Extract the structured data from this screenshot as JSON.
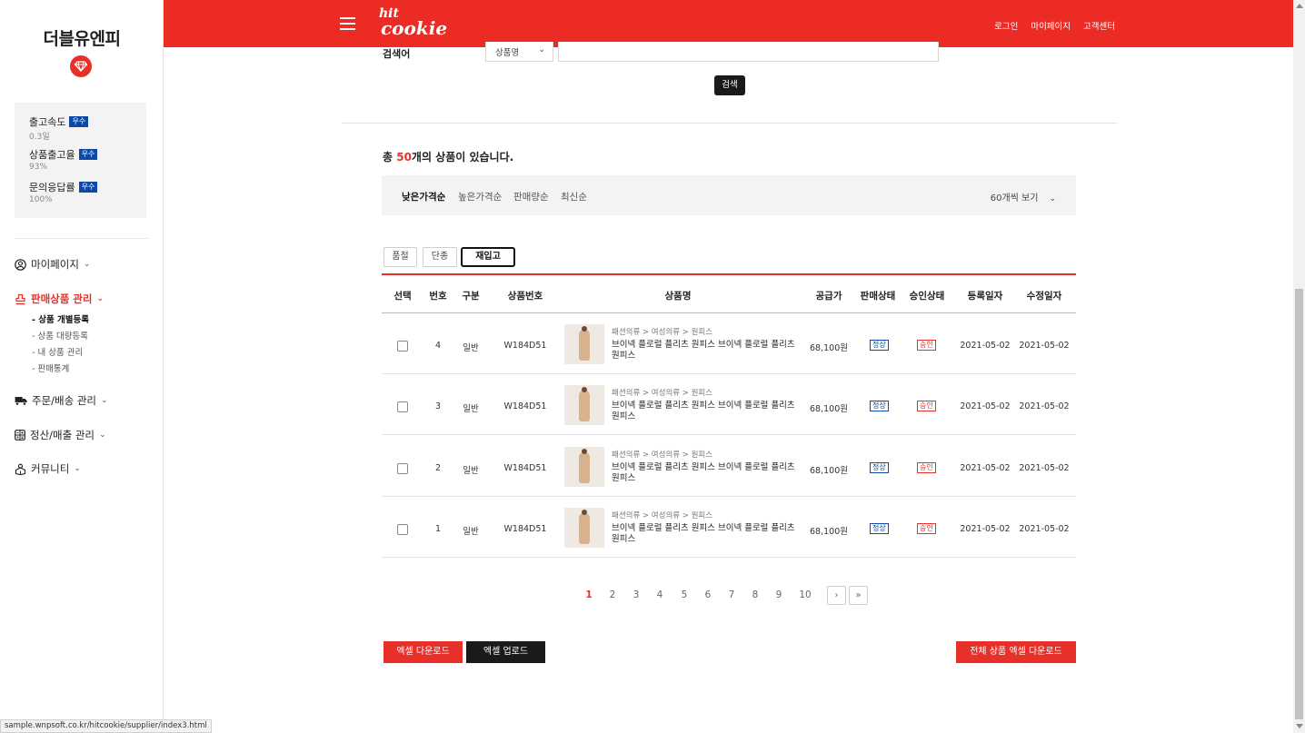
{
  "sidebar": {
    "brand": "더블유엔피",
    "stats": [
      {
        "label": "출고속도",
        "badge": "우수",
        "value": "0.3일"
      },
      {
        "label": "상품출고율",
        "badge": "우수",
        "value": "93%"
      },
      {
        "label": "문의응답률",
        "badge": "우수",
        "value": "100%"
      }
    ],
    "nav": [
      {
        "label": "마이페이지",
        "icon": "user-circle-icon"
      },
      {
        "label": "판매상품 관리",
        "icon": "stamp-icon",
        "active": true,
        "sub": [
          "- 상품 개별등록",
          "- 상품 대량등록",
          "- 내 상품 관리",
          "- 판매통계"
        ]
      },
      {
        "label": "주문/배송 관리",
        "icon": "truck-icon"
      },
      {
        "label": "정산/매출 관리",
        "icon": "calculator-icon"
      },
      {
        "label": "커뮤니티",
        "icon": "people-icon"
      }
    ]
  },
  "topbar": {
    "logo_line1": "hit",
    "logo_line2": "cookie",
    "links": [
      "로그인",
      "마이페이지",
      "고객센터"
    ],
    "color": "#ed2b25"
  },
  "search": {
    "label": "검색어",
    "select_value": "상품명",
    "button": "검색"
  },
  "summary": {
    "prefix": "총 ",
    "count": "50",
    "suffix": "개의 상품이 있습니다."
  },
  "sort": {
    "options": [
      "낮은가격순",
      "높은가격순",
      "판매량순",
      "최신순"
    ],
    "per_page": "60개씩 보기"
  },
  "tabs": [
    "품절",
    "단종",
    "재입고"
  ],
  "table": {
    "headers": [
      "선택",
      "번호",
      "구분",
      "상품번호",
      "상품명",
      "공급가",
      "판매상태",
      "승인상태",
      "등록일자",
      "수정일자"
    ],
    "rows": [
      {
        "no": "4",
        "type": "일반",
        "code": "W184D51",
        "category": "패션의류 > 여성의류 > 원피스",
        "name": "브이넥 플로럴 플리츠 원피스 브이넥 플로럴 플리츠 원피스",
        "price": "68,100원",
        "sale": "정상",
        "approve": "승인",
        "reg": "2021-05-02",
        "mod": "2021-05-02"
      },
      {
        "no": "3",
        "type": "일반",
        "code": "W184D51",
        "category": "패션의류 > 여성의류 > 원피스",
        "name": "브이넥 플로럴 플리츠 원피스 브이넥 플로럴 플리츠 원피스",
        "price": "68,100원",
        "sale": "정상",
        "approve": "승인",
        "reg": "2021-05-02",
        "mod": "2021-05-02"
      },
      {
        "no": "2",
        "type": "일반",
        "code": "W184D51",
        "category": "패션의류 > 여성의류 > 원피스",
        "name": "브이넥 플로럴 플리츠 원피스 브이넥 플로럴 플리츠 원피스",
        "price": "68,100원",
        "sale": "정상",
        "approve": "승인",
        "reg": "2021-05-02",
        "mod": "2021-05-02"
      },
      {
        "no": "1",
        "type": "일반",
        "code": "W184D51",
        "category": "패션의류 > 여성의류 > 원피스",
        "name": "브이넥 플로럴 플리츠 원피스 브이넥 플로럴 플리츠 원피스",
        "price": "68,100원",
        "sale": "정상",
        "approve": "승인",
        "reg": "2021-05-02",
        "mod": "2021-05-02"
      }
    ]
  },
  "pagination": {
    "pages": [
      "1",
      "2",
      "3",
      "4",
      "5",
      "6",
      "7",
      "8",
      "9",
      "10"
    ],
    "current": "1",
    "next": "›",
    "last": "»"
  },
  "actions": {
    "excel_download": "엑셀 다운로드",
    "excel_upload": "엑셀 업로드",
    "all_excel_download": "전체 상품 엑셀 다운로드"
  },
  "status_url": "sample.wnpsoft.co.kr/hitcookie/supplier/index3.html"
}
